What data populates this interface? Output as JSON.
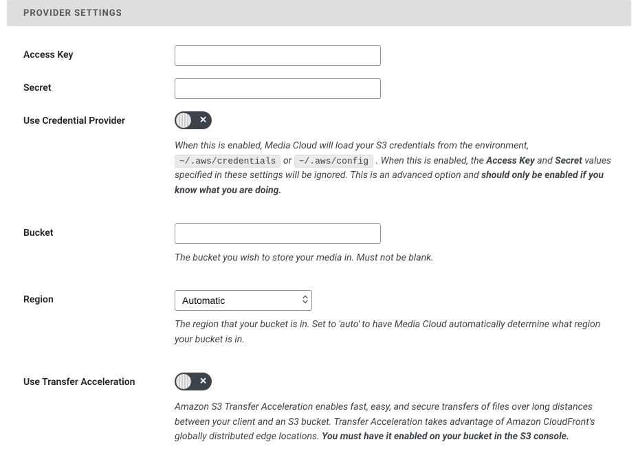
{
  "panel": {
    "title": "PROVIDER SETTINGS"
  },
  "fields": {
    "access_key": {
      "label": "Access Key",
      "value": ""
    },
    "secret": {
      "label": "Secret",
      "value": ""
    },
    "use_cred_provider": {
      "label": "Use Credential Provider",
      "enabled": false,
      "desc_intro": "When this is enabled, Media Cloud will load your S3 credentials from the environment, ",
      "code1": "~/.aws/credentials",
      "desc_or": " or ",
      "code2": "~/.aws/config",
      "desc_mid1": ". When this is enabled, the ",
      "strong_ak": "Access Key",
      "desc_and": " and ",
      "strong_secret": "Secret",
      "desc_mid2": " values specified in these settings will be ignored. This is an advanced option and ",
      "strong_warn": "should only be enabled if you know what you are doing."
    },
    "bucket": {
      "label": "Bucket",
      "value": "",
      "desc": "The bucket you wish to store your media in. Must not be blank."
    },
    "region": {
      "label": "Region",
      "selected": "Automatic",
      "options": [
        "Automatic"
      ],
      "desc": "The region that your bucket is in. Set to 'auto' to have Media Cloud automatically determine what region your bucket is in."
    },
    "transfer_accel": {
      "label": "Use Transfer Acceleration",
      "enabled": false,
      "desc_text": "Amazon S3 Transfer Acceleration enables fast, easy, and secure transfers of files over long distances between your client and an S3 bucket. Transfer Acceleration takes advantage of Amazon CloudFront's globally distributed edge locations. ",
      "strong_note": "You must have it enabled on your bucket in the S3 console."
    }
  },
  "icons": {
    "toggle_off": "✕"
  }
}
